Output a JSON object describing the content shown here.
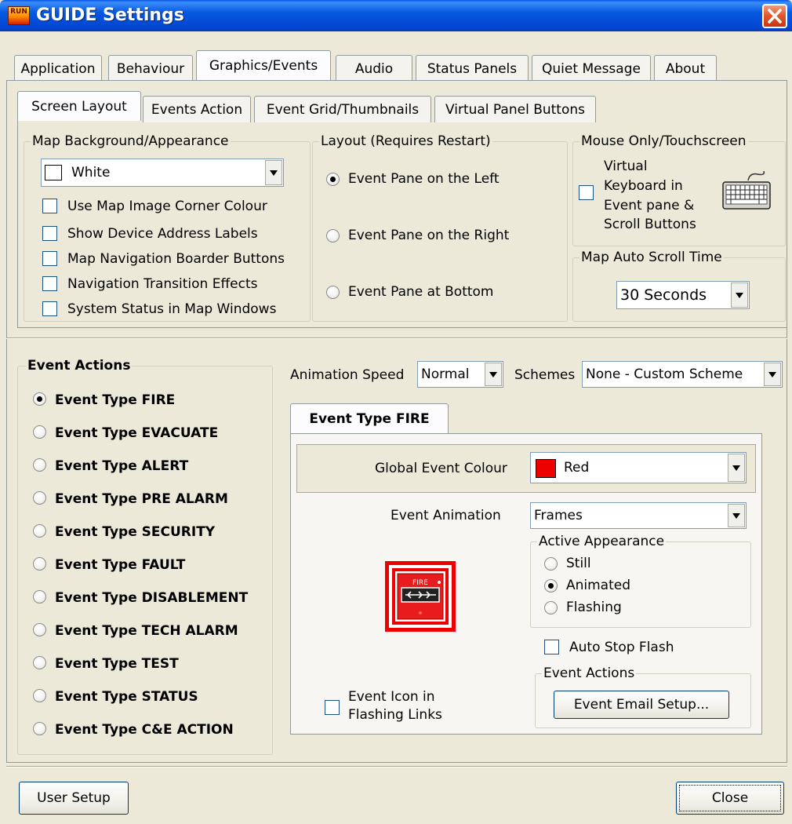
{
  "window": {
    "title": "GUIDE Settings",
    "app_icon_text": "RUN"
  },
  "main_tabs": [
    "Application",
    "Behaviour",
    "Graphics/Events",
    "Audio",
    "Status Panels",
    "Quiet Message",
    "About"
  ],
  "sub_tabs": [
    "Screen Layout",
    "Events Action",
    "Event Grid/Thumbnails",
    "Virtual Panel Buttons"
  ],
  "map_background": {
    "title": "Map Background/Appearance",
    "colour_value": "White",
    "colour_swatch": "#ffffff",
    "options": [
      {
        "label": "Use Map Image Corner Colour",
        "checked": false
      },
      {
        "label": "Show Device Address Labels",
        "checked": false
      },
      {
        "label": "Map Navigation Boarder Buttons",
        "checked": false
      },
      {
        "label": "Navigation Transition Effects",
        "checked": false
      },
      {
        "label": "System Status in Map Windows",
        "checked": false
      }
    ]
  },
  "layout": {
    "title": "Layout (Requires Restart)",
    "options": [
      {
        "label": "Event Pane on the Left",
        "selected": true
      },
      {
        "label": "Event Pane on the Right",
        "selected": false
      },
      {
        "label": "Event Pane at Bottom",
        "selected": false
      }
    ]
  },
  "mouse": {
    "title": "Mouse Only/Touchscreen",
    "label_lines": [
      "Virtual",
      "Keyboard in",
      "Event pane &",
      "Scroll Buttons"
    ],
    "checked": false
  },
  "auto_scroll": {
    "title": "Map Auto Scroll Time",
    "value": "30 Seconds"
  },
  "event_actions": {
    "title": "Event Actions",
    "types": [
      {
        "label": "Event Type FIRE",
        "selected": true
      },
      {
        "label": "Event Type EVACUATE",
        "selected": false
      },
      {
        "label": "Event Type ALERT",
        "selected": false
      },
      {
        "label": "Event Type PRE ALARM",
        "selected": false
      },
      {
        "label": "Event Type SECURITY",
        "selected": false
      },
      {
        "label": "Event Type FAULT",
        "selected": false
      },
      {
        "label": "Event Type DISABLEMENT",
        "selected": false
      },
      {
        "label": "Event Type TECH ALARM",
        "selected": false
      },
      {
        "label": "Event Type TEST",
        "selected": false
      },
      {
        "label": "Event Type STATUS",
        "selected": false
      },
      {
        "label": "Event Type C&E ACTION",
        "selected": false
      }
    ]
  },
  "animation_speed": {
    "label": "Animation Speed",
    "value": "Normal"
  },
  "schemes": {
    "label": "Schemes",
    "value": "None - Custom Scheme"
  },
  "event_detail": {
    "tab_label": "Event Type FIRE",
    "global_colour_label": "Global Event Colour",
    "global_colour_value": "Red",
    "global_colour_swatch": "#ee0000",
    "animation_label": "Event Animation",
    "animation_value": "Frames",
    "icon_text": "FIRE",
    "active_appearance": {
      "title": "Active Appearance",
      "options": [
        {
          "label": "Still",
          "selected": false
        },
        {
          "label": "Animated",
          "selected": true
        },
        {
          "label": "Flashing",
          "selected": false
        }
      ]
    },
    "auto_stop_flash": {
      "label": "Auto Stop Flash",
      "checked": false
    },
    "flashing_links": {
      "label_lines": [
        "Event Icon in",
        "Flashing Links"
      ],
      "checked": false
    },
    "event_actions_group": {
      "title": "Event Actions",
      "email_button": "Event Email Setup..."
    }
  },
  "footer": {
    "user_setup": "User Setup",
    "close": "Close"
  }
}
